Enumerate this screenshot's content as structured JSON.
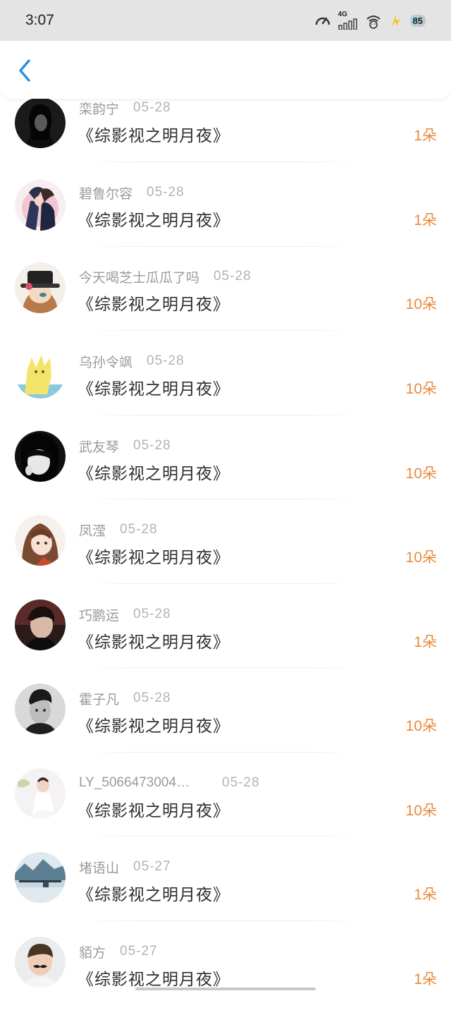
{
  "status_bar": {
    "time": "3:07",
    "network": "4G",
    "battery": "85"
  },
  "nav": {
    "back_icon": "chevron-left-icon",
    "accent": "#2a8de0"
  },
  "colors": {
    "amount": "#ea8a3a",
    "name": "#9a9a9a",
    "title": "#2e2e2e"
  },
  "rows": [
    {
      "name": "栾韵宁",
      "date": "05-28",
      "title": "《综影视之明月夜》",
      "amount": "1朵",
      "avatar": "avatar-girl-dark-hair"
    },
    {
      "name": "碧鲁尔容",
      "date": "05-28",
      "title": "《综影视之明月夜》",
      "amount": "1朵",
      "avatar": "avatar-couple-illustration"
    },
    {
      "name": "今天喝芝士瓜瓜了吗",
      "date": "05-28",
      "title": "《综影视之明月夜》",
      "amount": "10朵",
      "avatar": "avatar-cartoon-girl-hat"
    },
    {
      "name": "乌孙令飒",
      "date": "05-28",
      "title": "《综影视之明月夜》",
      "amount": "10朵",
      "avatar": "avatar-yellow-cartoon"
    },
    {
      "name": "武友琴",
      "date": "05-28",
      "title": "《综影视之明月夜》",
      "amount": "10朵",
      "avatar": "avatar-woman-bw"
    },
    {
      "name": "凤滢",
      "date": "05-28",
      "title": "《综影视之明月夜》",
      "amount": "10朵",
      "avatar": "avatar-anime-girl"
    },
    {
      "name": "巧鹏运",
      "date": "05-28",
      "title": "《综影视之明月夜》",
      "amount": "1朵",
      "avatar": "avatar-man-dark"
    },
    {
      "name": "霍子凡",
      "date": "05-28",
      "title": "《综影视之明月夜》",
      "amount": "10朵",
      "avatar": "avatar-man-bw"
    },
    {
      "name": "LY_5066473004…",
      "date": "05-28",
      "title": "《综影视之明月夜》",
      "amount": "10朵",
      "avatar": "avatar-child-white"
    },
    {
      "name": "堵语山",
      "date": "05-27",
      "title": "《综影视之明月夜》",
      "amount": "1朵",
      "avatar": "avatar-landscape"
    },
    {
      "name": "貊方",
      "date": "05-27",
      "title": "《综影视之明月夜》",
      "amount": "1朵",
      "avatar": "avatar-kid-mustache"
    }
  ]
}
